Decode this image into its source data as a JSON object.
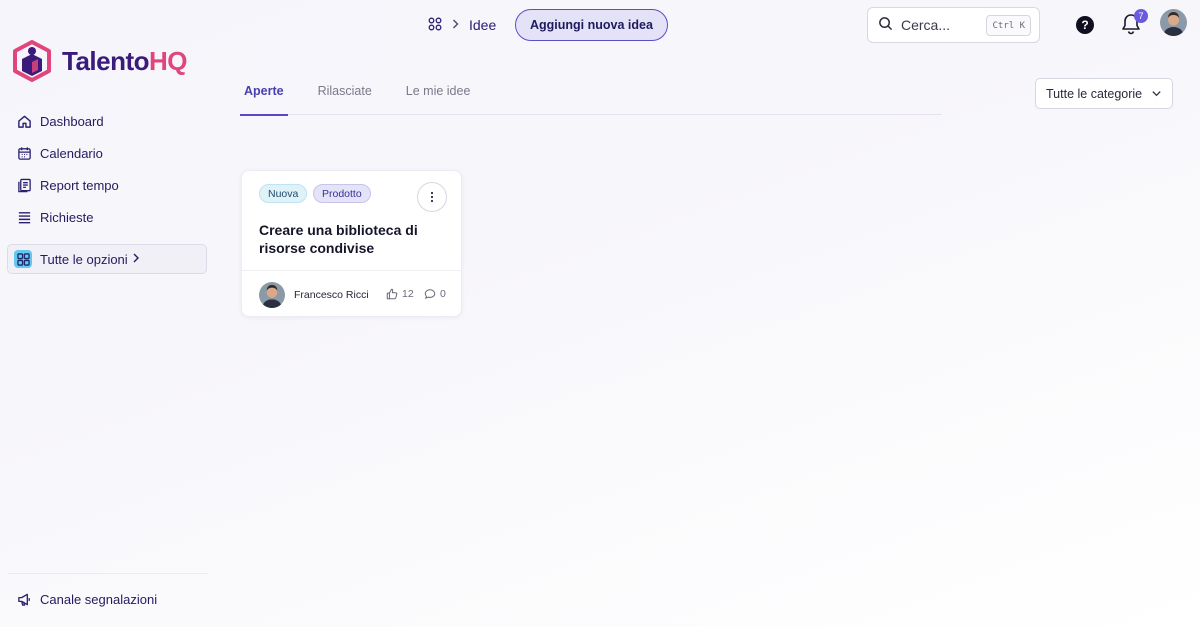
{
  "brand": {
    "name_part1": "Talento",
    "name_part2": "HQ",
    "color_primary": "#3a1a7a",
    "color_accent": "#e0457b"
  },
  "sidebar": {
    "items": [
      {
        "label": "Dashboard",
        "icon": "home-icon"
      },
      {
        "label": "Calendario",
        "icon": "calendar-icon"
      },
      {
        "label": "Report tempo",
        "icon": "report-icon"
      },
      {
        "label": "Richieste",
        "icon": "list-icon"
      }
    ],
    "all_options": {
      "label": "Tutte le opzioni",
      "icon": "grid-icon"
    },
    "bottom": {
      "label": "Canale segnalazioni",
      "icon": "megaphone-icon"
    }
  },
  "header": {
    "breadcrumb": {
      "current": "Idee"
    },
    "add_button": "Aggiungi nuova idea",
    "search": {
      "placeholder": "Cerca...",
      "shortcut": "Ctrl K"
    },
    "notifications_count": "7"
  },
  "tabs": [
    {
      "label": "Aperte",
      "active": true
    },
    {
      "label": "Rilasciate",
      "active": false
    },
    {
      "label": "Le mie idee",
      "active": false
    }
  ],
  "category_filter": {
    "selected": "Tutte le categorie"
  },
  "ideas": [
    {
      "tags": [
        "Nuova",
        "Prodotto"
      ],
      "title": "Creare una biblioteca di risorse condivise",
      "author": "Francesco Ricci",
      "likes": "12",
      "comments": "0"
    }
  ]
}
